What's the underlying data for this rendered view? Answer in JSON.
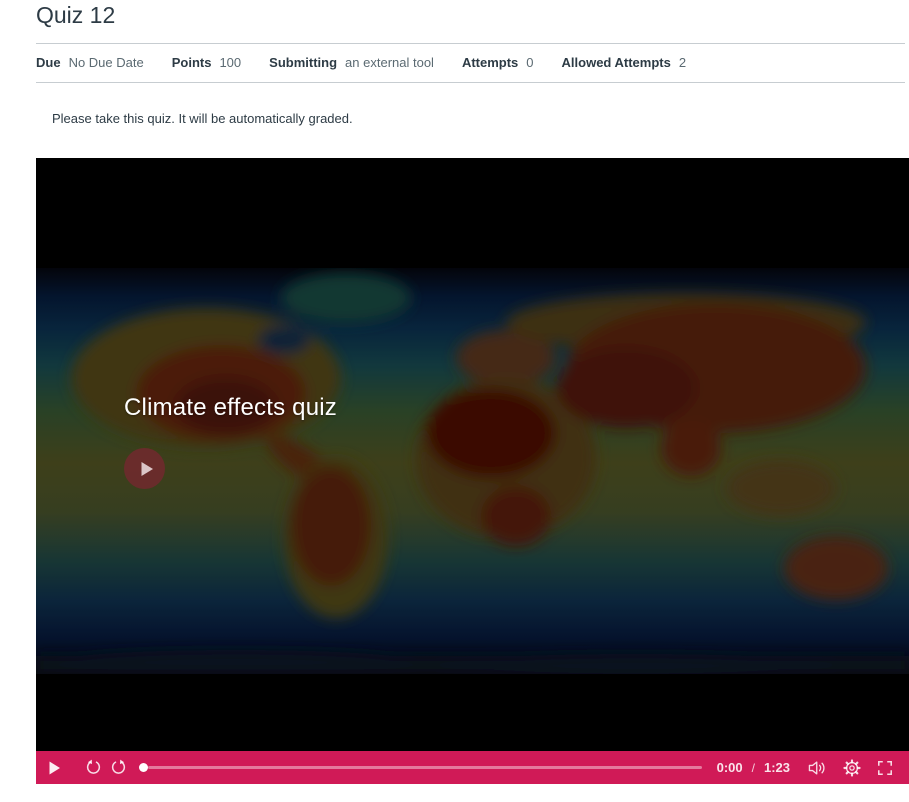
{
  "theme": {
    "accent": "#d01a57",
    "header_text": "#2d3b45",
    "meta_value_text": "#5b6a72",
    "play_overlay_color": "#6e2a2c",
    "ocean_dark": "#061a38",
    "ocean_teal": "#16454b",
    "land_olive": "#4c4e20",
    "land_hot_red": "#55200e"
  },
  "header": {
    "title": "Quiz 12"
  },
  "meta": {
    "items": [
      {
        "label": "Due",
        "value": "No Due Date"
      },
      {
        "label": "Points",
        "value": "100"
      },
      {
        "label": "Submitting",
        "value": "an external tool"
      },
      {
        "label": "Attempts",
        "value": "0"
      },
      {
        "label": "Allowed Attempts",
        "value": "2"
      }
    ]
  },
  "content": {
    "instructions": "Please take this quiz. It will be automatically graded."
  },
  "video": {
    "overlay_title": "Climate effects quiz",
    "thumbnail_description": "world-climate-heatmap",
    "controls": {
      "current_time": "0:00",
      "time_separator": "/",
      "duration": "1:23",
      "progress_percent": 0
    },
    "icons": {
      "big_play": "circled-play-triangle",
      "play": "play-triangle",
      "rewind": "arrow-rotate-counterclockwise",
      "forward": "arrow-rotate-clockwise",
      "volume": "speaker-with-waves",
      "settings": "gear",
      "fullscreen": "corner-brackets"
    }
  }
}
